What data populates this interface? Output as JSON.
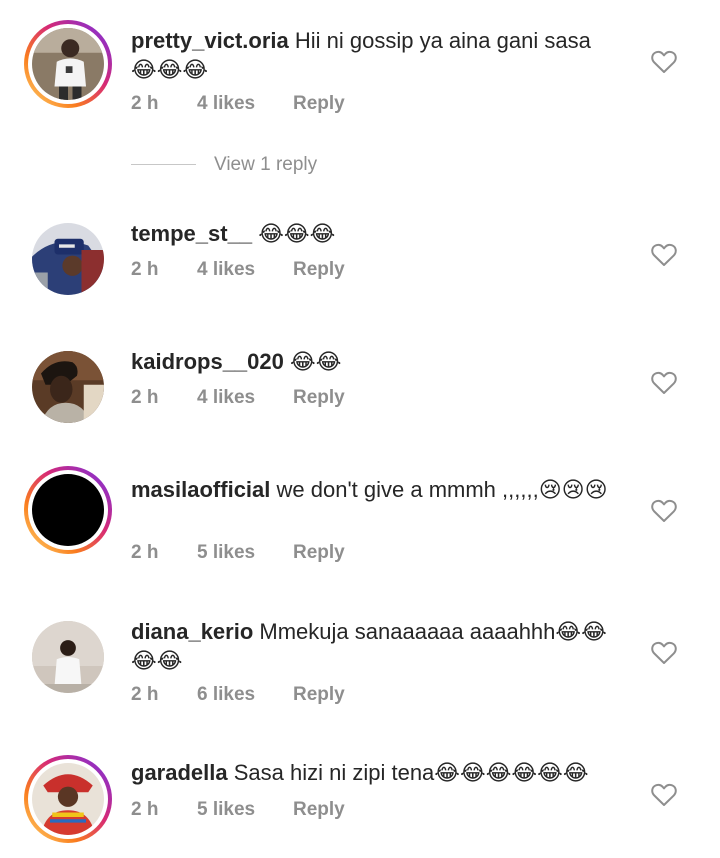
{
  "comments": [
    {
      "username": "pretty_vict.oria",
      "text": "Hii ni gossip ya aina gani sasa 😂😂😂",
      "time": "2 h",
      "likes": "4 likes",
      "reply": "Reply",
      "has_story_ring": true
    },
    {
      "username": "tempe_st__",
      "text": "😂😂😂",
      "time": "2 h",
      "likes": "4 likes",
      "reply": "Reply",
      "has_story_ring": false
    },
    {
      "username": "kaidrops__020",
      "text": "😂😂",
      "time": "2 h",
      "likes": "4 likes",
      "reply": "Reply",
      "has_story_ring": false
    },
    {
      "username": "masilaofficial",
      "text": "we don't give a mmmh ,,,,,,😢😢😢",
      "time": "2 h",
      "likes": "5 likes",
      "reply": "Reply",
      "has_story_ring": true
    },
    {
      "username": "diana_kerio",
      "text": "Mmekuja sanaaaaaa aaaahhh😂😂😂😂",
      "time": "2 h",
      "likes": "6 likes",
      "reply": "Reply",
      "has_story_ring": false
    },
    {
      "username": "garadella",
      "text": "Sasa hizi ni zipi tena😂😂😂😂😂😂",
      "time": "2 h",
      "likes": "5 likes",
      "reply": "Reply",
      "has_story_ring": true
    }
  ],
  "view_replies": {
    "label": "View 1 reply"
  },
  "icons": {
    "like": "heart-outline-icon"
  },
  "colors": {
    "text": "#262626",
    "secondary": "#8e8e8e",
    "divider": "#c7c7c7"
  }
}
